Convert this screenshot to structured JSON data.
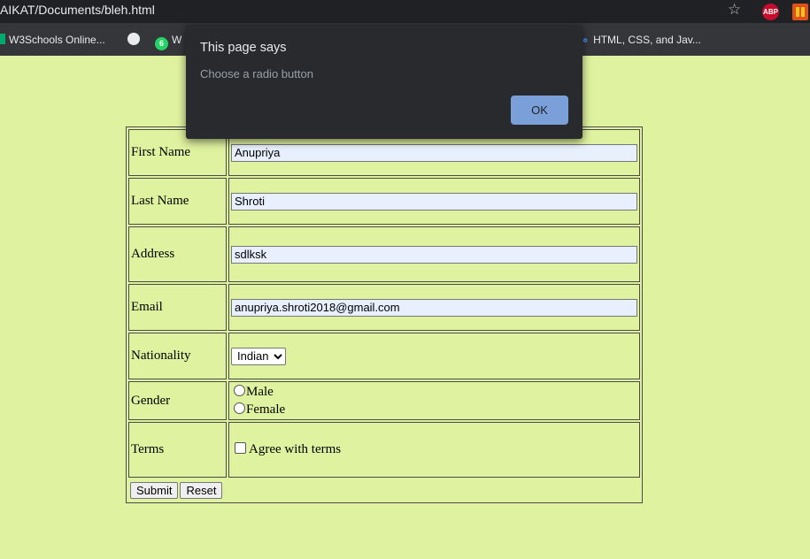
{
  "browser": {
    "url": "AIKAT/Documents/bleh.html",
    "bookmarks": [
      {
        "label": "W3Schools Online...",
        "icon": "w3schools-icon"
      },
      {
        "label": "",
        "icon": "globe-icon"
      },
      {
        "label": "W",
        "icon": "whatsapp-icon",
        "badge": "6"
      },
      {
        "label": "HTML, CSS, and Jav...",
        "icon": "html-icon"
      }
    ],
    "extensions": {
      "abp": "ABP"
    }
  },
  "form": {
    "first_name": {
      "label": "First Name",
      "value": "Anupriya"
    },
    "last_name": {
      "label": "Last Name",
      "value": "Shroti"
    },
    "address": {
      "label": "Address",
      "value": "sdlksk"
    },
    "email": {
      "label": "Email",
      "value": "anupriya.shroti2018@gmail.com"
    },
    "nationality": {
      "label": "Nationality",
      "selected": "Indian"
    },
    "gender": {
      "label": "Gender",
      "options": [
        "Male",
        "Female"
      ]
    },
    "terms": {
      "label": "Terms",
      "checkbox_label": "Agree with terms"
    },
    "submit_label": "Submit",
    "reset_label": "Reset"
  },
  "dialog": {
    "title": "This page says",
    "message": "Choose a radio button",
    "ok_label": "OK"
  },
  "colors": {
    "page_background": "#dff29f",
    "dialog_background": "#292a2d",
    "ok_button": "#8ab4f8"
  }
}
